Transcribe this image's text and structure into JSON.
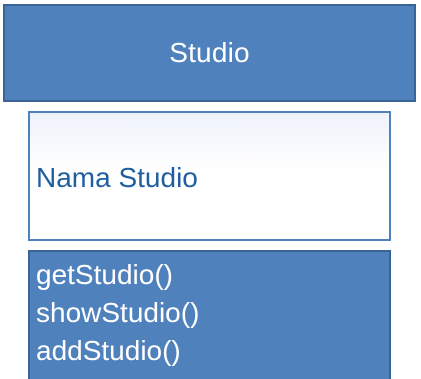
{
  "diagram": {
    "class_name": "Studio",
    "attributes": [
      "Nama Studio"
    ],
    "methods": [
      "getStudio()",
      "showStudio()",
      "addStudio()"
    ]
  },
  "colors": {
    "header_fill": "#4f81bd",
    "header_border": "#3a6496",
    "attribute_text": "#1f5fa0",
    "method_fill": "#4f81bd",
    "text_on_fill": "#ffffff"
  }
}
